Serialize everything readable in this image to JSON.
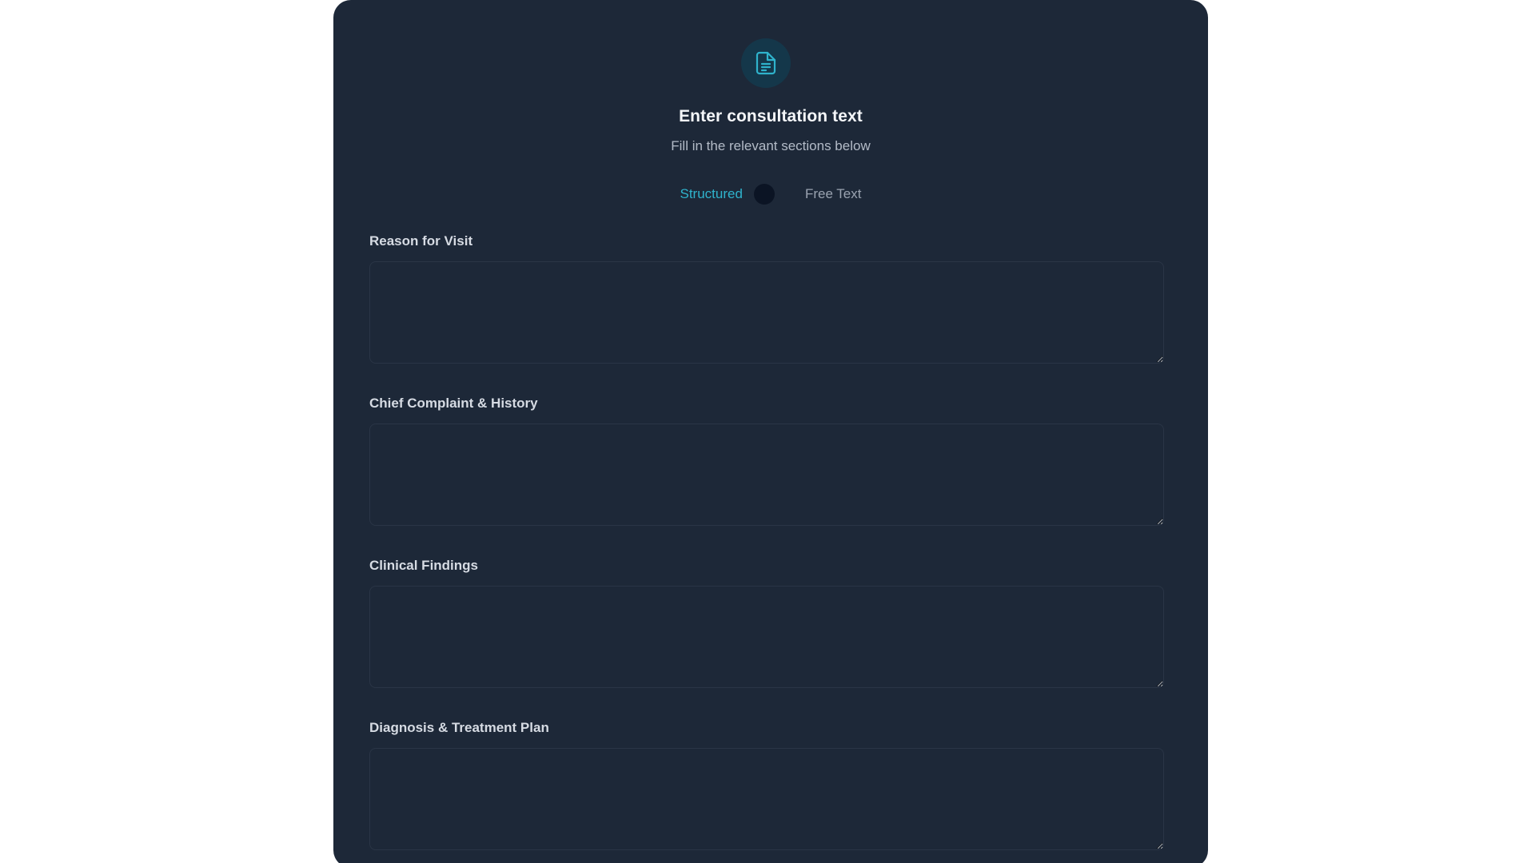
{
  "header": {
    "icon": "document-icon",
    "title": "Enter consultation text",
    "subtitle": "Fill in the relevant sections below"
  },
  "mode_toggle": {
    "left_label": "Structured",
    "right_label": "Free Text",
    "selected": "Structured"
  },
  "sections": [
    {
      "label": "Reason for Visit",
      "value": ""
    },
    {
      "label": "Chief Complaint & History",
      "value": ""
    },
    {
      "label": "Clinical Findings",
      "value": ""
    },
    {
      "label": "Diagnosis & Treatment Plan",
      "value": ""
    }
  ],
  "colors": {
    "page_background": "#ffffff",
    "card_background": "#1d2838",
    "accent": "#2fb3cc",
    "icon_circle": "#14374a",
    "toggle_knob": "#0b1424",
    "field_border": "#2a3546"
  }
}
